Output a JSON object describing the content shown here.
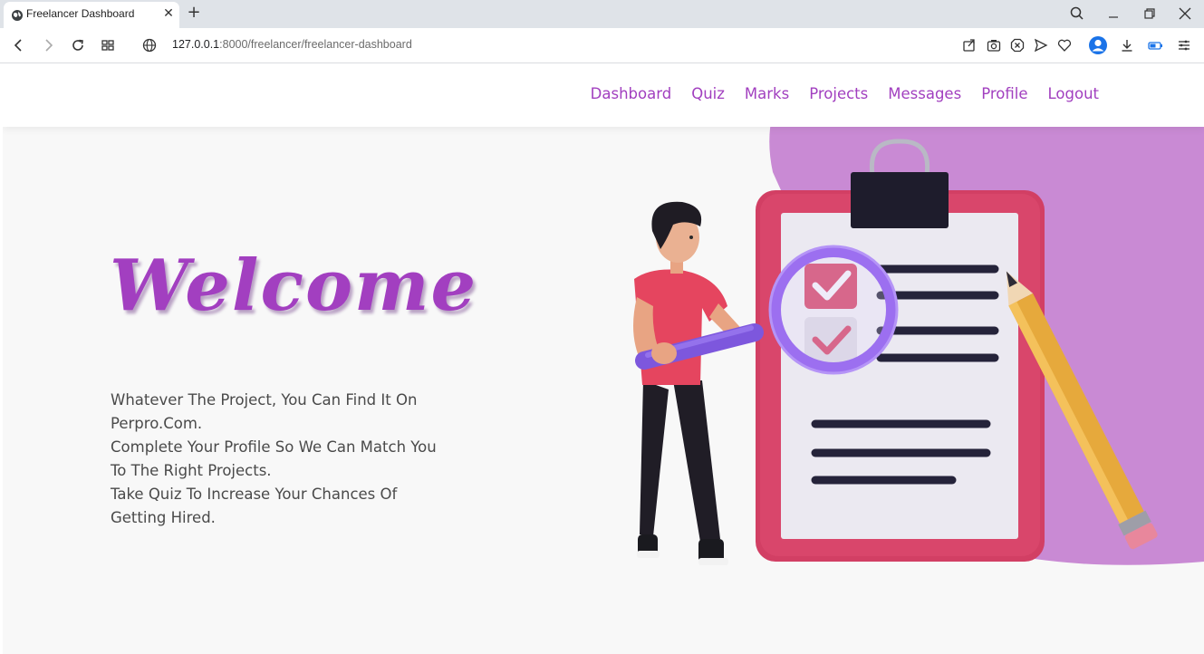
{
  "browser": {
    "tab_title": "Freelancer Dashboard",
    "url_host": "127.0.0.1",
    "url_rest": ":8000/freelancer/freelancer-dashboard",
    "colors": {
      "tabbar": "#dfe3e8",
      "accent": "#1a73e8"
    }
  },
  "nav": {
    "links": [
      "Dashboard",
      "Quiz",
      "Marks",
      "Projects",
      "Messages",
      "Profile",
      "Logout"
    ]
  },
  "hero": {
    "title": "Welcome",
    "lines": [
      "Whatever The Project, You Can Find It On Perpro.Com.",
      "Complete Your Profile So We Can Match You To The Right Projects.",
      "Take Quiz To Increase Your Chances Of Getting Hired."
    ]
  },
  "theme": {
    "brand": "#a13fbf",
    "blob": "#c98ad4",
    "clipboard": "#d23f64"
  }
}
